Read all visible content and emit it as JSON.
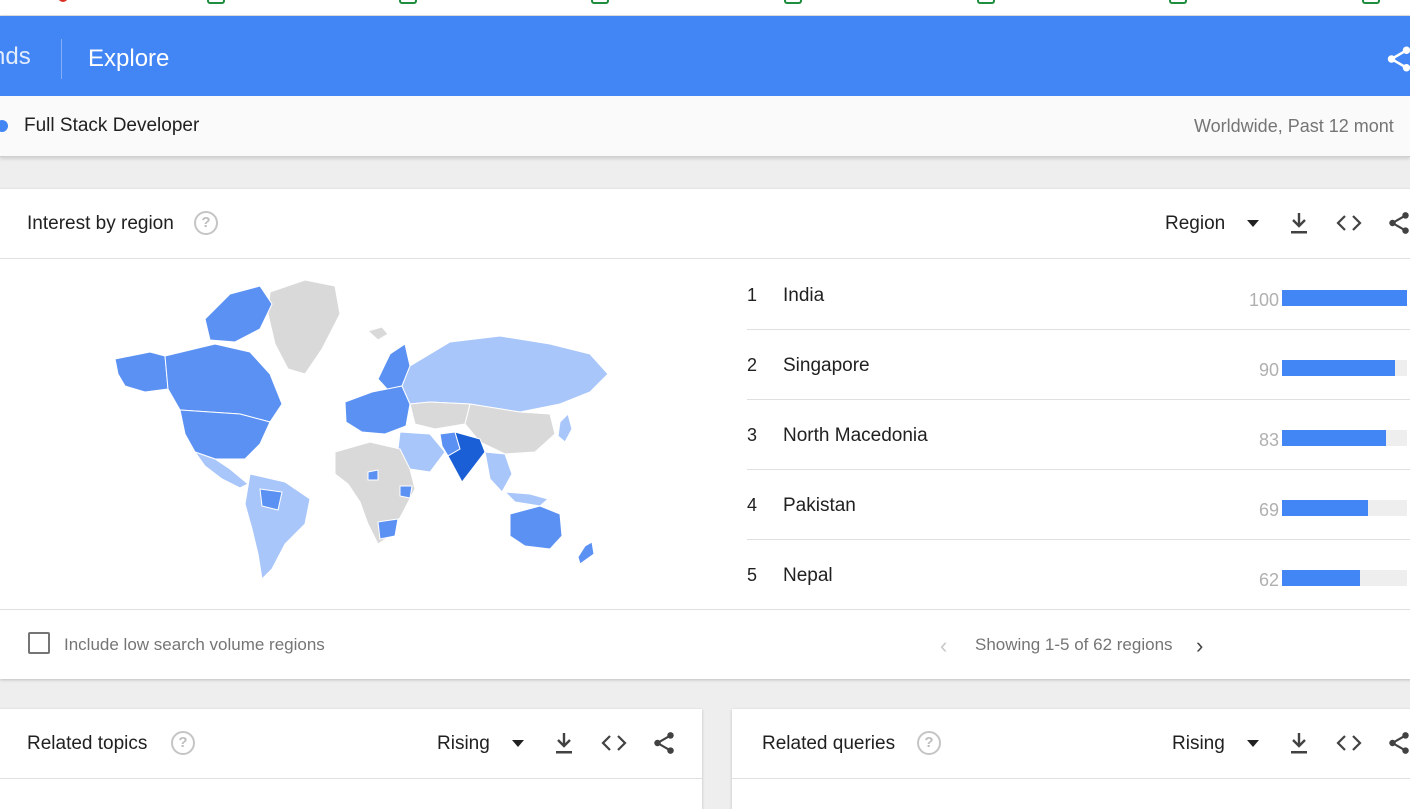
{
  "header": {
    "brand_partial": "nds",
    "page_title": "Explore"
  },
  "search_term": {
    "name": "Full Stack Developer",
    "meta": "Worldwide, Past 12 mont"
  },
  "interest_by_region": {
    "title": "Interest by region",
    "help": "?",
    "resolution_label": "Region",
    "rows": [
      {
        "rank": "1",
        "region": "India",
        "value": "100",
        "fraction": 1.0
      },
      {
        "rank": "2",
        "region": "Singapore",
        "value": "90",
        "fraction": 0.9
      },
      {
        "rank": "3",
        "region": "North Macedonia",
        "value": "83",
        "fraction": 0.83
      },
      {
        "rank": "4",
        "region": "Pakistan",
        "value": "69",
        "fraction": 0.69
      },
      {
        "rank": "5",
        "region": "Nepal",
        "value": "62",
        "fraction": 0.62
      }
    ],
    "include_low_volume_label": "Include low search volume regions",
    "pager_text": "Showing 1-5 of 62 regions",
    "pager_prev": "‹",
    "pager_next": "›"
  },
  "related_topics": {
    "title": "Related topics",
    "help": "?",
    "filter_label": "Rising"
  },
  "related_queries": {
    "title": "Related queries",
    "help": "?",
    "filter_label": "Rising"
  },
  "colors": {
    "primary": "#4285f4",
    "map_strong": "#1a5fd6",
    "map_medium": "#5b91f3",
    "map_light": "#a8c6fa",
    "map_none": "#d9d9d9"
  }
}
